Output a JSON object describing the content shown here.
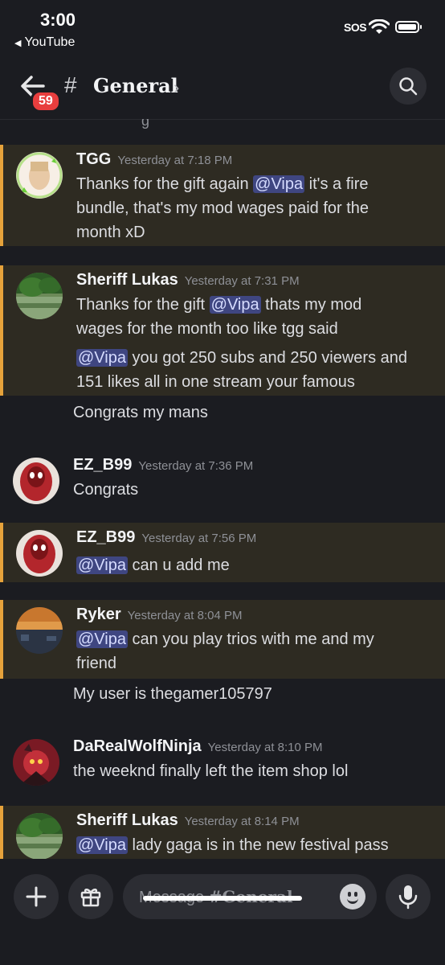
{
  "status_bar": {
    "time": "3:00",
    "back_app": "YouTube",
    "sos": "SOS"
  },
  "header": {
    "unread_badge": "59",
    "channel_name": "General",
    "hash": "#",
    "chevron": "›"
  },
  "partial_top": {
    "text": "g"
  },
  "messages": [
    {
      "author": "TGG",
      "time": "Yesterday at 7:18 PM",
      "mention": true,
      "lines": [
        [
          "Thanks for the gift again ",
          "@Vipa",
          " it's a fire"
        ],
        [
          "bundle, that's my mod wages paid for the"
        ],
        [
          "month xD"
        ]
      ]
    },
    {
      "author": "Sheriff Lukas",
      "time": "Yesterday at 7:31 PM",
      "mention": true,
      "lines": [
        [
          "Thanks for the gift  ",
          "@Vipa",
          "  thats my mod"
        ],
        [
          "wages for the month too like tgg said"
        ]
      ],
      "lines2": [
        [
          "",
          "@Vipa",
          " you got 250 subs and 250  viewers and"
        ],
        [
          "151 likes all in one stream your famous"
        ]
      ],
      "continuation": "Congrats my mans"
    },
    {
      "author": "EZ_B99",
      "time": "Yesterday at 7:36 PM",
      "mention": false,
      "text": "Congrats"
    },
    {
      "author": "EZ_B99",
      "time": "Yesterday at 7:56 PM",
      "mention": true,
      "lines": [
        [
          "",
          "@Vipa",
          "  can u add me"
        ]
      ]
    },
    {
      "author": "Ryker",
      "time": "Yesterday at 8:04 PM",
      "mention": true,
      "lines": [
        [
          "",
          "@Vipa",
          " can you play trios with me and my"
        ],
        [
          "friend"
        ]
      ],
      "continuation": "My user is thegamer105797"
    },
    {
      "author": "DaRealWolfNinja",
      "time": "Yesterday at 8:10 PM",
      "mention": false,
      "text": "the weeknd finally left the item shop lol"
    },
    {
      "author": "Sheriff Lukas",
      "time": "Yesterday at 8:14 PM",
      "mention": true,
      "lines": [
        [
          "",
          "@Vipa",
          "  lady gaga is in the new festival  pass"
        ]
      ]
    }
  ],
  "input": {
    "placeholder_prefix": "Message ",
    "placeholder_channel": "#General"
  },
  "icons": {
    "back": "arrow-left-icon",
    "search": "search-icon",
    "add": "plus-icon",
    "gift": "gift-icon",
    "emoji": "emoji-icon",
    "mic": "microphone-icon"
  },
  "colors": {
    "background": "#1b1c21",
    "mention_bg": "#2e2b22",
    "mention_bar": "#e6a23b",
    "pill": "#3f4681",
    "badge": "#e83e3e"
  }
}
